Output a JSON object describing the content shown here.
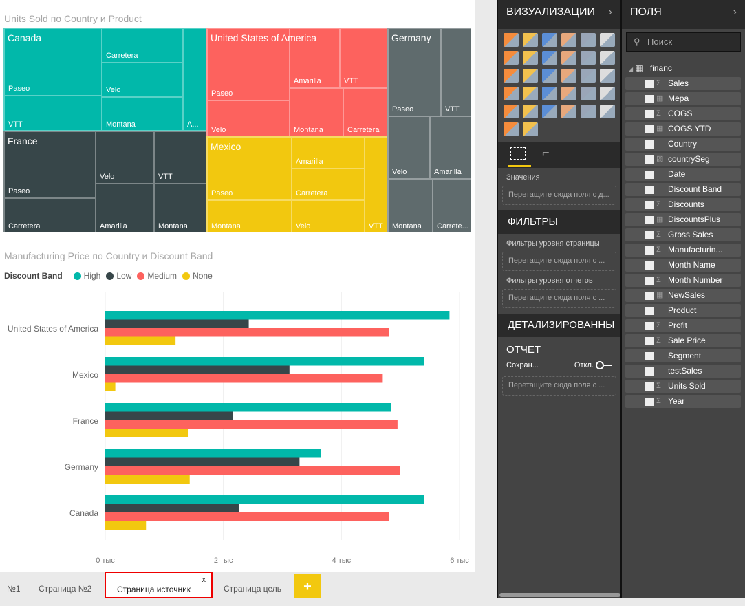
{
  "treemap": {
    "title": "Units Sold по Country и Product",
    "countries": [
      {
        "name": "Canada",
        "color": "#01b8aa",
        "products": [
          "Paseo",
          "VTT",
          "Carretera",
          "Velo",
          "Montana",
          "A..."
        ]
      },
      {
        "name": "France",
        "color": "#374649",
        "products": [
          "Paseo",
          "Velo",
          "VTT",
          "Carretera",
          "Amarilla",
          "Montana"
        ]
      },
      {
        "name": "United States of America",
        "color": "#fd625e",
        "products": [
          "Paseo",
          "Velo",
          "Amarilla",
          "VTT",
          "Montana",
          "Carretera"
        ]
      },
      {
        "name": "Mexico",
        "color": "#f2c80f",
        "products": [
          "Paseo",
          "Montana",
          "Amarilla",
          "Carretera",
          "Velo",
          "VTT"
        ]
      },
      {
        "name": "Germany",
        "color": "#5f6b6d",
        "products": [
          "Paseo",
          "VTT",
          "Velo",
          "Amarilla",
          "Montana",
          "Carrete..."
        ]
      }
    ]
  },
  "chart_data": {
    "type": "bar",
    "orientation": "horizontal",
    "title": "Manufacturing Price по Country и Discount Band",
    "legend_title": "Discount Band",
    "legend_position": "top-left",
    "categories": [
      "United States of America",
      "Mexico",
      "France",
      "Germany",
      "Canada"
    ],
    "series": [
      {
        "name": "High",
        "color": "#01b8aa",
        "values": [
          5830,
          5400,
          4840,
          3650,
          5400
        ]
      },
      {
        "name": "Low",
        "color": "#374649",
        "values": [
          2430,
          3120,
          2160,
          3290,
          2260
        ]
      },
      {
        "name": "Medium",
        "color": "#fd625e",
        "values": [
          4800,
          4700,
          4950,
          4990,
          4800
        ]
      },
      {
        "name": "None",
        "color": "#f2c80f",
        "values": [
          1190,
          170,
          1410,
          1430,
          690
        ]
      }
    ],
    "xticks": [
      "0 тыс",
      "2 тыс",
      "4 тыс",
      "6 тыс"
    ],
    "xlim": [
      0,
      6000
    ],
    "grid": true
  },
  "tabs": [
    "№1",
    "Страница №2",
    "Страница источник",
    "Страница цель"
  ],
  "tab_close": "x",
  "add_tab": "+",
  "viz": {
    "title": "ВИЗУАЛИЗАЦИИ",
    "values_label": "Значения",
    "drop1": "Перетащите сюда поля с д...",
    "filters": "ФИЛЬТРЫ",
    "page_filters": "Фильтры уровня страницы",
    "drop2": "Перетащите сюда поля с ...",
    "report_filters": "Фильтры уровня отчетов",
    "drop3": "Перетащите сюда поля с ...",
    "drill": "ДЕТАЛИЗИРОВАННЫ",
    "report": "ОТЧЕТ",
    "keep": "Сохран...",
    "toggle": "Откл.",
    "drop4": "Перетащите сюда поля с ..."
  },
  "fields": {
    "title": "ПОЛЯ",
    "search": "Поиск",
    "table": "financ",
    "items": [
      [
        "Sales",
        "Σ"
      ],
      [
        "Мера",
        "▦"
      ],
      [
        "COGS",
        "Σ"
      ],
      [
        "COGS YTD",
        "▦"
      ],
      [
        "Country",
        ""
      ],
      [
        "countrySeg",
        "▨"
      ],
      [
        "Date",
        ""
      ],
      [
        "Discount Band",
        ""
      ],
      [
        "Discounts",
        "Σ"
      ],
      [
        "DiscountsPlus",
        "▦"
      ],
      [
        "Gross Sales",
        "Σ"
      ],
      [
        "Manufacturin...",
        "Σ"
      ],
      [
        "Month Name",
        ""
      ],
      [
        "Month Number",
        "Σ"
      ],
      [
        "NewSales",
        "▦"
      ],
      [
        "Product",
        ""
      ],
      [
        "Profit",
        "Σ"
      ],
      [
        "Sale Price",
        "Σ"
      ],
      [
        "Segment",
        ""
      ],
      [
        "testSales",
        ""
      ],
      [
        "Units Sold",
        "Σ"
      ],
      [
        "Year",
        "Σ"
      ]
    ]
  }
}
